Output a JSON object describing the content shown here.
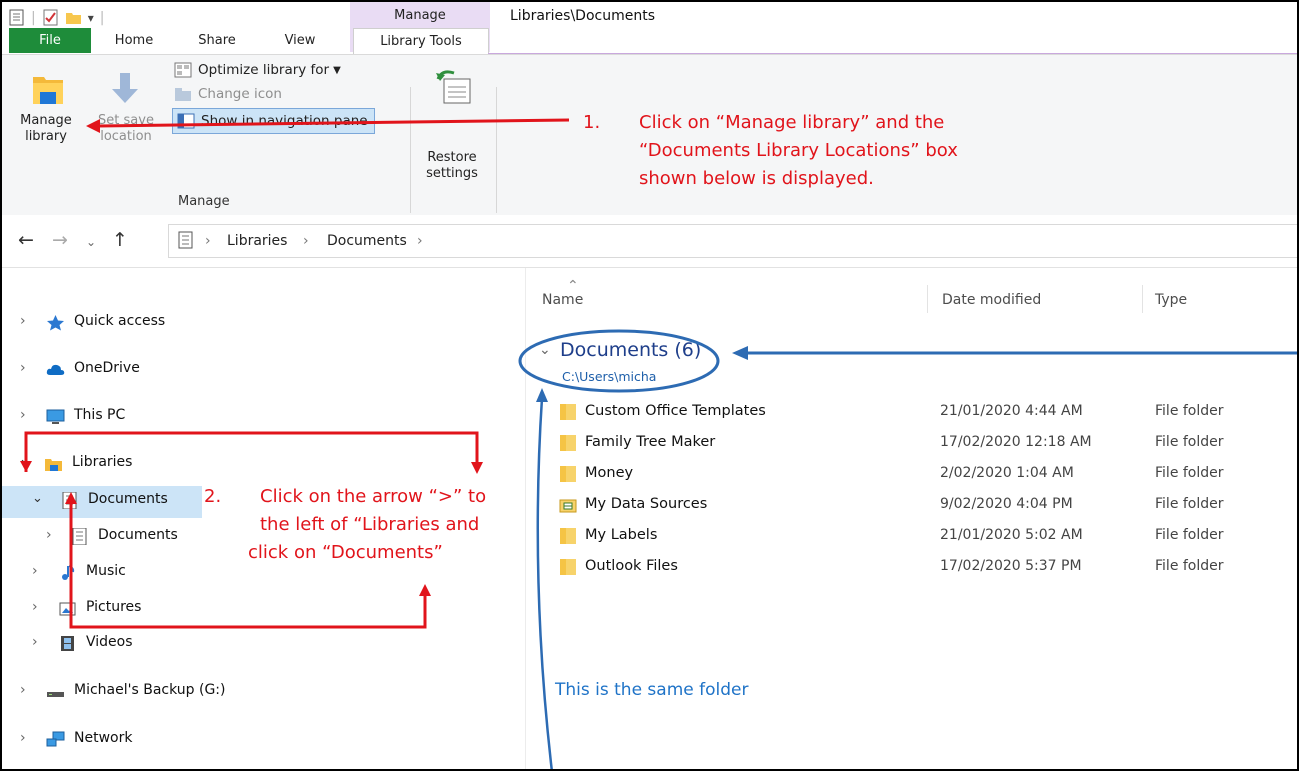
{
  "window": {
    "title": "Libraries\\Documents",
    "context_tab": "Manage"
  },
  "tabs": [
    {
      "label": "File"
    },
    {
      "label": "Home"
    },
    {
      "label": "Share"
    },
    {
      "label": "View"
    },
    {
      "label": "Library Tools"
    }
  ],
  "ribbon": {
    "manage_library_line1": "Manage",
    "manage_library_line2": "library",
    "set_save_line1": "Set save",
    "set_save_line2": "location",
    "optimize": "Optimize library for",
    "change_icon": "Change icon",
    "show_nav": "Show in navigation pane",
    "restore_line1": "Restore",
    "restore_line2": "settings",
    "group_label": "Manage"
  },
  "address": {
    "crumbs": [
      "Libraries",
      "Documents"
    ]
  },
  "nav": {
    "items": [
      {
        "label": "Quick access",
        "icon": "star-icon"
      },
      {
        "label": "OneDrive",
        "icon": "cloud-icon"
      },
      {
        "label": "This PC",
        "icon": "monitor-icon"
      },
      {
        "label": "Libraries",
        "icon": "libraries-icon"
      },
      {
        "label": "Documents",
        "icon": "document-icon"
      },
      {
        "label": "Documents",
        "icon": "document-icon"
      },
      {
        "label": "Music",
        "icon": "music-icon"
      },
      {
        "label": "Pictures",
        "icon": "pictures-icon"
      },
      {
        "label": "Videos",
        "icon": "film-icon"
      },
      {
        "label": "Michael's Backup (G:)",
        "icon": "drive-icon"
      },
      {
        "label": "Network",
        "icon": "network-icon"
      }
    ]
  },
  "content": {
    "columns": {
      "name": "Name",
      "date": "Date modified",
      "type": "Type"
    },
    "group_title": "Documents (6)",
    "group_path": "C:\\Users\\micha",
    "files": [
      {
        "name": "Custom Office Templates",
        "date": "21/01/2020 4:44 AM",
        "type": "File folder"
      },
      {
        "name": "Family Tree Maker",
        "date": "17/02/2020 12:18 AM",
        "type": "File folder"
      },
      {
        "name": "Money",
        "date": "2/02/2020 1:04 AM",
        "type": "File folder"
      },
      {
        "name": "My Data Sources",
        "date": "9/02/2020 4:04 PM",
        "type": "File folder"
      },
      {
        "name": "My Labels",
        "date": "21/01/2020 5:02 AM",
        "type": "File folder"
      },
      {
        "name": "Outlook Files",
        "date": "17/02/2020 5:37 PM",
        "type": "File folder"
      }
    ]
  },
  "annotations": {
    "step1_num": "1.",
    "step1_l1": "Click on “Manage library” and the",
    "step1_l2": "“Documents Library Locations” box",
    "step1_l3": "shown below is displayed.",
    "step2_num": "2.",
    "step2_l1": "Click on the arrow “>” to",
    "step2_l2": "the left of “Libraries and",
    "step2_l3": "click on “Documents”",
    "same_folder": "This is the same folder"
  },
  "colors": {
    "file_tab": "#1e8c3a",
    "manage_context": "#e9dcf4",
    "annotation_red": "#e1141b",
    "annotation_blue": "#2d6bb3",
    "selection": "#cce4f7"
  }
}
